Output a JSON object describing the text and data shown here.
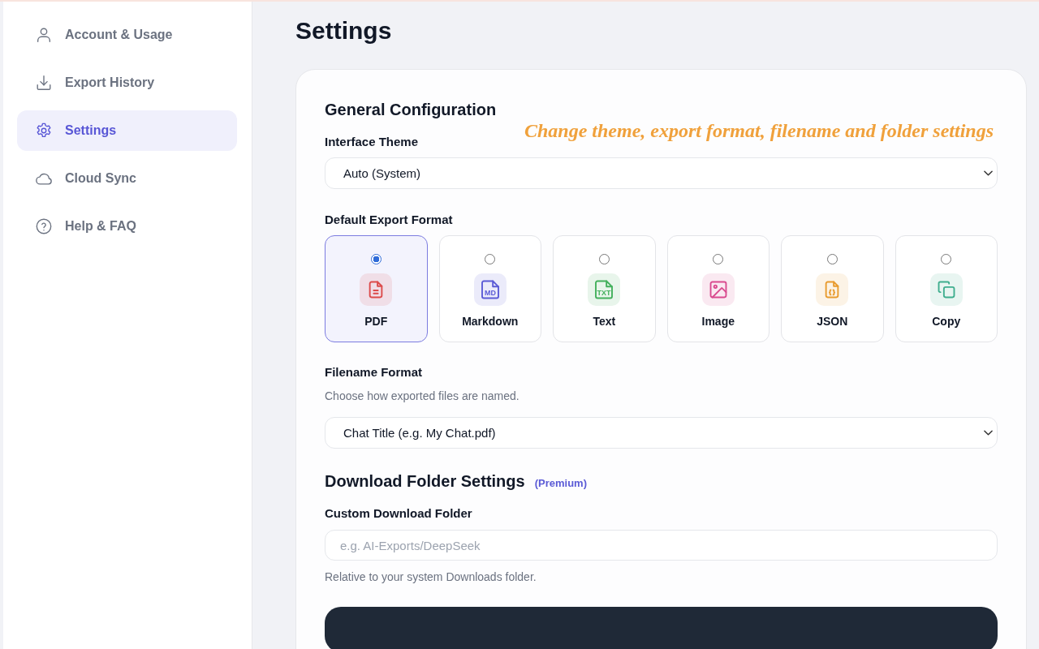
{
  "sidebar": {
    "items": [
      {
        "kind": "account",
        "label": "Account & Usage",
        "selected": false
      },
      {
        "kind": "history",
        "label": "Export History",
        "selected": false
      },
      {
        "kind": "settings",
        "label": "Settings",
        "selected": true
      },
      {
        "kind": "sync",
        "label": "Cloud Sync",
        "selected": false
      },
      {
        "kind": "help",
        "label": "Help & FAQ",
        "selected": false
      }
    ]
  },
  "page": {
    "title": "Settings"
  },
  "caption": "Change theme, export format, filename and folder settings",
  "general": {
    "heading": "General Configuration",
    "theme": {
      "label": "Interface Theme",
      "value": "Auto (System)"
    },
    "export_format": {
      "label": "Default Export Format",
      "options": [
        {
          "kind": "pdf",
          "label": "PDF",
          "color": "#dc4b4b",
          "selected": true
        },
        {
          "kind": "markdown",
          "label": "Markdown",
          "icon_text": "MD",
          "color": "#5b5bd6",
          "selected": false
        },
        {
          "kind": "text",
          "label": "Text",
          "icon_text": "TXT",
          "color": "#43b05c",
          "selected": false
        },
        {
          "kind": "image",
          "label": "Image",
          "color": "#d94b8f",
          "selected": false
        },
        {
          "kind": "json",
          "label": "JSON",
          "color": "#e89b2e",
          "selected": false
        },
        {
          "kind": "copy",
          "label": "Copy",
          "color": "#3fae8e",
          "selected": false
        }
      ]
    },
    "filename": {
      "label": "Filename Format",
      "hint": "Choose how exported files are named.",
      "value": "Chat Title (e.g. My Chat.pdf)"
    }
  },
  "download_folder": {
    "heading": "Download Folder Settings",
    "badge": "(Premium)",
    "field": {
      "label": "Custom Download Folder",
      "placeholder": "e.g. AI-Exports/DeepSeek"
    },
    "hint": "Relative to your system Downloads folder."
  }
}
